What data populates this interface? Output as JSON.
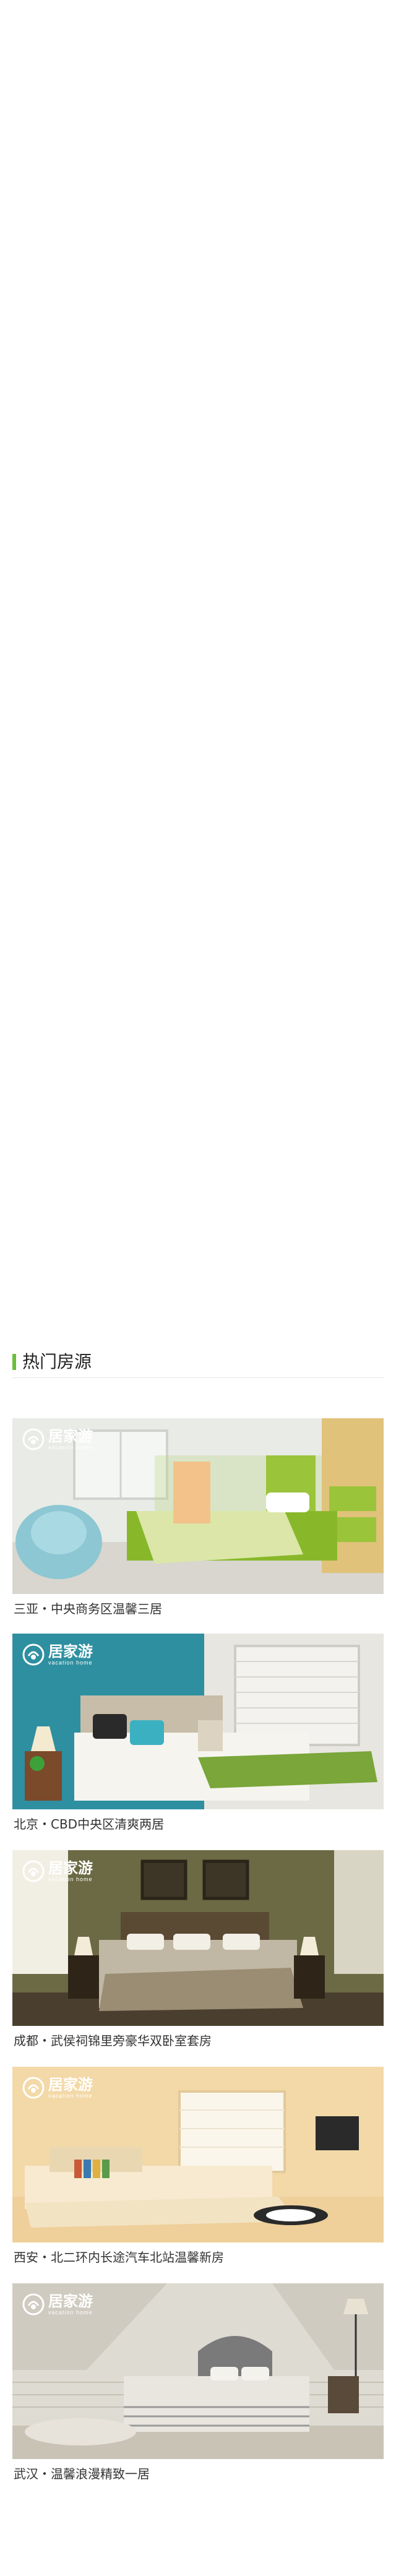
{
  "section": {
    "title": "热门房源"
  },
  "brand": {
    "logo_cn": "居家游",
    "logo_en": "vacation home"
  },
  "colors": {
    "accent": "#6abf3b"
  },
  "houses": [
    {
      "caption": "三亚・中央商务区温馨三居"
    },
    {
      "caption": "北京・CBD中央区清爽两居"
    },
    {
      "caption": "成都・武侯祠锦里旁豪华双卧室套房"
    },
    {
      "caption": "西安・北二环内长途汽车北站温馨新房"
    },
    {
      "caption": "武汉・温馨浪漫精致一居"
    }
  ]
}
